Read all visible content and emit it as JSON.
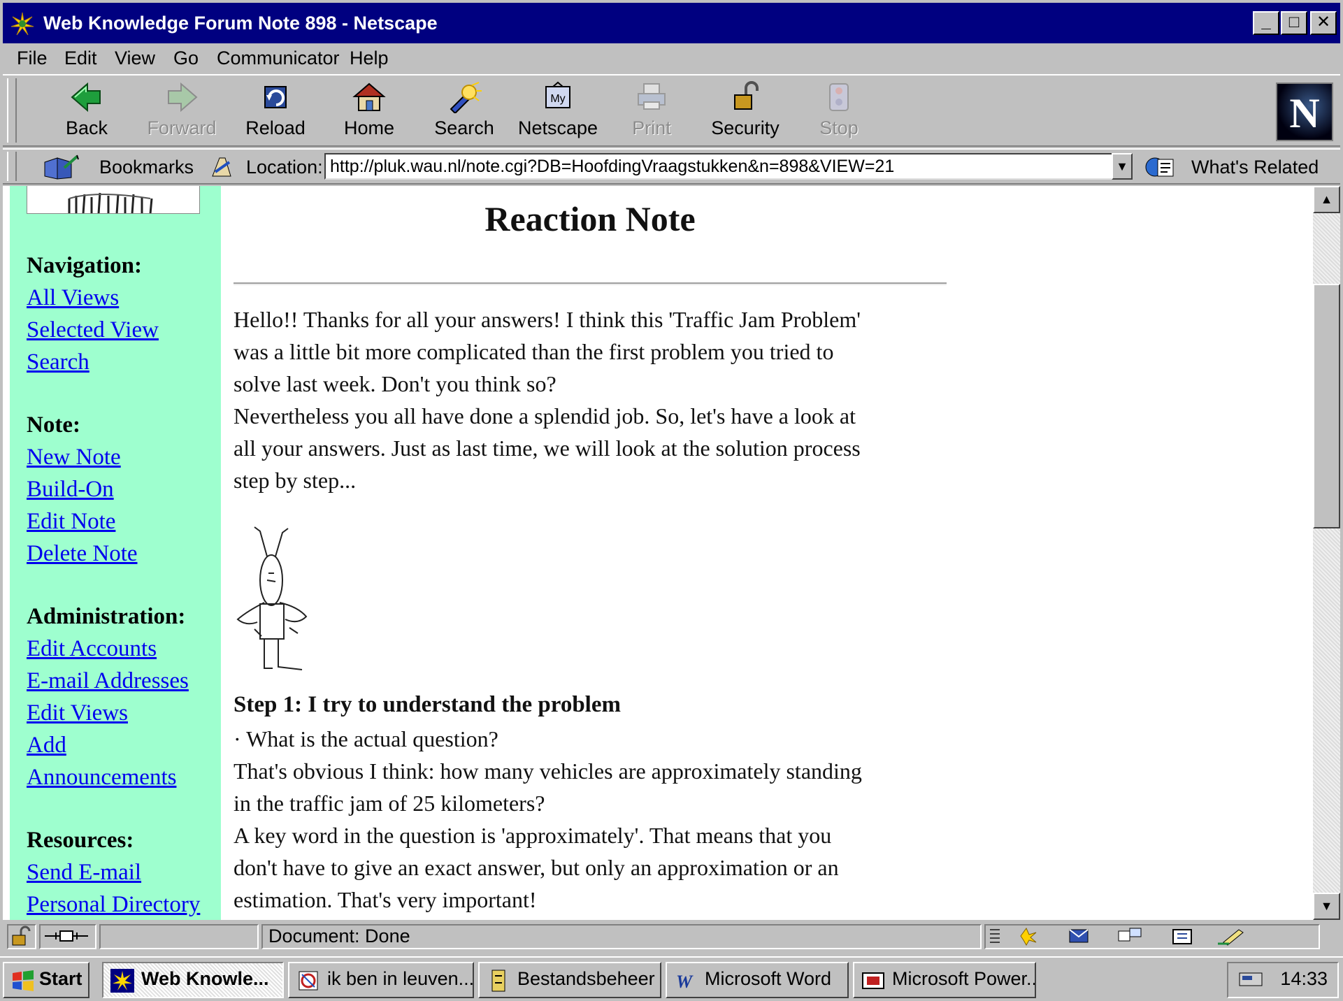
{
  "window": {
    "title": "Web Knowledge Forum Note 898 - Netscape",
    "controls": [
      "_",
      "□",
      "✕"
    ]
  },
  "menu": [
    "File",
    "Edit",
    "View",
    "Go",
    "Communicator",
    "Help"
  ],
  "toolbar": {
    "buttons": [
      {
        "label": "Back",
        "icon": "back-arrow-icon",
        "enabled": true
      },
      {
        "label": "Forward",
        "icon": "forward-arrow-icon",
        "enabled": false
      },
      {
        "label": "Reload",
        "icon": "reload-icon",
        "enabled": true
      },
      {
        "label": "Home",
        "icon": "home-icon",
        "enabled": true
      },
      {
        "label": "Search",
        "icon": "search-flashlight-icon",
        "enabled": true
      },
      {
        "label": "Netscape",
        "icon": "my-netscape-icon",
        "enabled": true
      },
      {
        "label": "Print",
        "icon": "printer-icon",
        "enabled": false
      },
      {
        "label": "Security",
        "icon": "padlock-icon",
        "enabled": true
      },
      {
        "label": "Stop",
        "icon": "stop-icon",
        "enabled": false
      }
    ],
    "logo": "N"
  },
  "location_bar": {
    "bookmarks_label": "Bookmarks",
    "location_label": "Location:",
    "url": "http://pluk.wau.nl/note.cgi?DB=HoofdingVraagstukken&n=898&VIEW=21",
    "related_label": "What's Related"
  },
  "sidebar": {
    "sections": [
      {
        "heading": "Navigation:",
        "links": [
          "All Views",
          "Selected View",
          "Search"
        ]
      },
      {
        "heading": "Note:",
        "links": [
          "New Note",
          "Build-On",
          "Edit Note",
          "Delete Note"
        ]
      },
      {
        "heading": "Administration:",
        "links": [
          "Edit Accounts",
          "E-mail Addresses",
          "Edit Views",
          "Add",
          "Announcements"
        ]
      },
      {
        "heading": "Resources:",
        "links": [
          "Send E-mail",
          "Personal Directory"
        ]
      }
    ]
  },
  "note": {
    "title": "Reaction Note",
    "intro_lines": [
      "Hello!! Thanks for all your answers! I think this 'Traffic Jam Problem'",
      "was a little bit more complicated than the first problem you tried to",
      "solve last week. Don't you think so?",
      "Nevertheless you all have done a splendid job. So, let's have a look at",
      "all your answers. Just as last time, we will look at the solution process",
      "step by step..."
    ],
    "step1_title": "Step 1: I try to understand the problem",
    "step1_lines": [
      "· What is the actual question?",
      "That's obvious I think: how many vehicles are approximately standing",
      "in the traffic jam of 25 kilometers?",
      "A key word in the question is 'approximately'. That means that you",
      "don't have to give an exact answer, but only an approximation or an",
      "estimation. That's very important!"
    ]
  },
  "status": {
    "text": "Document: Done"
  },
  "taskbar": {
    "start_label": "Start",
    "tasks": [
      {
        "label": "Web Knowle...",
        "active": true
      },
      {
        "label": "ik ben in leuven...",
        "active": false
      },
      {
        "label": "Bestandsbeheer",
        "active": false
      },
      {
        "label": "Microsoft Word",
        "active": false
      },
      {
        "label": "Microsoft Power...",
        "active": false
      }
    ],
    "clock": "14:33"
  },
  "colors": {
    "titlebar": "#000080",
    "sidebar_bg": "#9effcf",
    "link": "#0000ee",
    "chrome": "#c0c0c0"
  }
}
